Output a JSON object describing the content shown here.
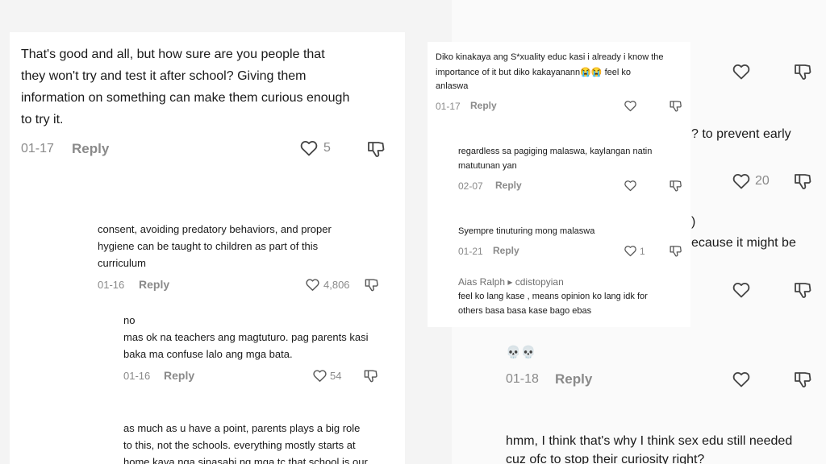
{
  "left": {
    "main": {
      "lines": [
        "That's good and all, but how sure are you people that",
        "they won't try and test it after school? Giving them",
        "information on something can make them curious enough",
        "to try it."
      ],
      "date": "01-17",
      "reply": "Reply",
      "likes": "5"
    },
    "r1": {
      "lines": [
        "consent, avoiding predatory behaviors, and proper",
        "hygiene can be taught to children as part of this",
        "curriculum"
      ],
      "date": "01-16",
      "reply": "Reply",
      "likes": "4,806"
    },
    "r2": {
      "lines": [
        "no",
        "mas ok na teachers ang magtuturo. pag parents kasi",
        "baka ma confuse lalo ang mga bata."
      ],
      "date": "01-16",
      "reply": "Reply",
      "likes": "54"
    },
    "r3": {
      "lines": [
        "as much as u have a point, parents plays a big role",
        "to this, not the schools. everything mostly starts at",
        "home kaya nga sinasabi ng mga tc that school is our"
      ]
    }
  },
  "right": {
    "bg": {
      "frag1": "? to prevent early",
      "likes2": "20",
      "frag2": ")",
      "frag3": "ecause it might be",
      "skull": "💀💀",
      "date": "01-18",
      "reply": "Reply",
      "bottom_lines": [
        "hmm, I think that's why I think sex edu still needed",
        "cuz ofc to stop their curiosity right?"
      ]
    },
    "c1": {
      "lines": [
        "Diko kinakaya ang S*xuality educ kasi i already i know the",
        "importance of it but diko kakayanann😭😭 feel ko",
        "anlaswa"
      ],
      "date": "01-17",
      "reply": "Reply"
    },
    "c2": {
      "lines": [
        "regardless sa pagiging malaswa, kaylangan natin",
        "matutunan yan"
      ],
      "date": "02-07",
      "reply": "Reply"
    },
    "c3": {
      "lines": [
        "Syempre tinuturing mong malaswa"
      ],
      "date": "01-21",
      "reply": "Reply",
      "likes": "1"
    },
    "c4": {
      "author": "Aias Ralph ▸ cdistopyian",
      "lines": [
        "feel ko lang kase , means opinion ko lang idk for",
        "others basa basa kase bago ebas"
      ]
    }
  },
  "icons": {
    "heart": "heart-icon",
    "dislike": "thumbs-down-icon"
  },
  "colors": {
    "text": "#1a1a1a",
    "muted": "#8a8a8a",
    "background": "#ffffff"
  }
}
